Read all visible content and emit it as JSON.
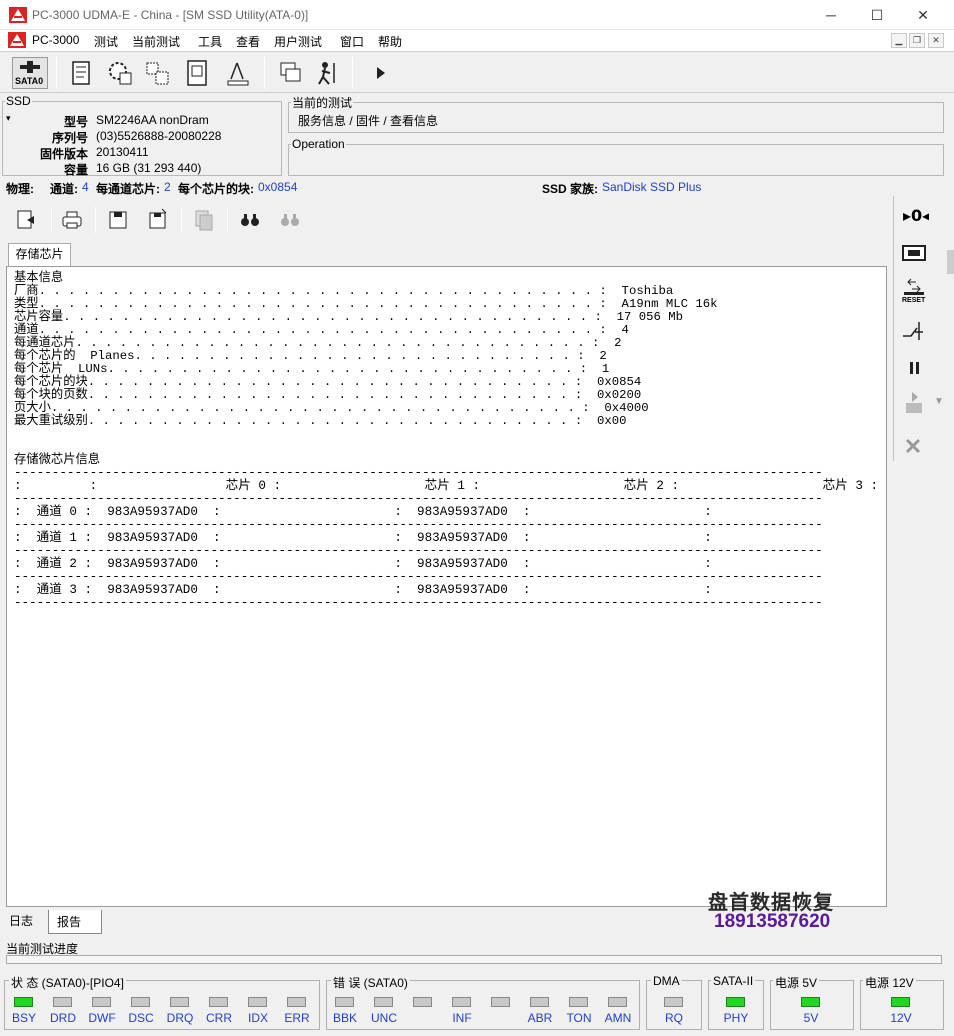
{
  "window": {
    "title": "PC-3000 UDMA-E - China - [SM SSD Utility(ATA-0)]",
    "min": "─",
    "max": "☐",
    "close": "✕"
  },
  "menu": [
    "PC-3000",
    "测试",
    "当前测试",
    "工具",
    "查看",
    "用户测试",
    "窗口",
    "帮助"
  ],
  "toolbar": {
    "sata_label": "SATA0"
  },
  "ssd": {
    "legend": "SSD",
    "model_label": "型号",
    "model": "SM2246AA nonDram",
    "serial_label": "序列号",
    "serial": "(03)5526888-20080228",
    "fw_label": "固件版本",
    "fw": "20130411",
    "cap_label": "容量",
    "cap": "16 GB (31 293 440)"
  },
  "current_test": {
    "legend": "当前的测试",
    "value": "服务信息 / 固件 / 查看信息"
  },
  "operation": {
    "legend": "Operation"
  },
  "phys": {
    "label": "物理:",
    "ch_label": "通道:",
    "ch": "4",
    "cpc_label": "每通道芯片:",
    "cpc": "2",
    "bpc_label": "每个芯片的块:",
    "bpc": "0x0854",
    "family_label": "SSD 家族:",
    "family": "SanDisk SSD Plus"
  },
  "tab": "存储芯片",
  "report": {
    "text": "基本信息\n厂商. . . . . . . . . . . . . . . . . . . . . . . . . . . . . . . . . . . . . . :  Toshiba\n类型. . . . . . . . . . . . . . . . . . . . . . . . . . . . . . . . . . . . . . :  A19nm MLC 16k\n芯片容量. . . . . . . . . . . . . . . . . . . . . . . . . . . . . . . . . . . . :  17 056 Mb\n通道. . . . . . . . . . . . . . . . . . . . . . . . . . . . . . . . . . . . . . :  4\n每通道芯片. . . . . . . . . . . . . . . . . . . . . . . . . . . . . . . . . . . :  2\n每个芯片的  Planes. . . . . . . . . . . . . . . . . . . . . . . . . . . . . . :  2\n每个芯片  LUNs. . . . . . . . . . . . . . . . . . . . . . . . . . . . . . . . :  1\n每个芯片的块. . . . . . . . . . . . . . . . . . . . . . . . . . . . . . . . . :  0x0854\n每个块的页数. . . . . . . . . . . . . . . . . . . . . . . . . . . . . . . . . :  0x0200\n页大小. . . . . . . . . . . . . . . . . . . . . . . . . . . . . . . . . . . . :  0x4000\n最大重试级别. . . . . . . . . . . . . . . . . . . . . . . . . . . . . . . . . :  0x00",
    "chip_title": "存储微芯片信息",
    "chip_table": "-----------------------------------------------------------------------------------------------------------\n:         :                 芯片 0 :                   芯片 1 :                   芯片 2 :                   芯片 3 :\n-----------------------------------------------------------------------------------------------------------\n:  通道 0 :  983A95937AD0  :                       :  983A95937AD0  :                       :\n-----------------------------------------------------------------------------------------------------------\n:  通道 1 :  983A95937AD0  :                       :  983A95937AD0  :                       :\n-----------------------------------------------------------------------------------------------------------\n:  通道 2 :  983A95937AD0  :                       :  983A95937AD0  :                       :\n-----------------------------------------------------------------------------------------------------------\n:  通道 3 :  983A95937AD0  :                       :  983A95937AD0  :                       :\n-----------------------------------------------------------------------------------------------------------"
  },
  "sidebar": {
    "reset_label": "RESET"
  },
  "bottom_tabs": [
    "日志",
    "报告"
  ],
  "watermark": {
    "line1": "盘首数据恢复",
    "line2": "18913587620"
  },
  "progress": {
    "label": "当前测试进度"
  },
  "status": {
    "state": {
      "title": "状 态 (SATA0)-[PIO4]",
      "leds": [
        {
          "l": "BSY",
          "on": true
        },
        {
          "l": "DRD",
          "on": false
        },
        {
          "l": "DWF",
          "on": false
        },
        {
          "l": "DSC",
          "on": false
        },
        {
          "l": "DRQ",
          "on": false
        },
        {
          "l": "CRR",
          "on": false
        },
        {
          "l": "IDX",
          "on": false
        },
        {
          "l": "ERR",
          "on": false
        }
      ]
    },
    "error": {
      "title": "错 误 (SATA0)",
      "leds": [
        {
          "l": "BBK",
          "on": false
        },
        {
          "l": "UNC",
          "on": false
        },
        {
          "l": "",
          "on": false
        },
        {
          "l": "INF",
          "on": false
        },
        {
          "l": "",
          "on": false
        },
        {
          "l": "ABR",
          "on": false
        },
        {
          "l": "TON",
          "on": false
        },
        {
          "l": "AMN",
          "on": false
        }
      ]
    },
    "dma": {
      "title": "DMA",
      "leds": [
        {
          "l": "RQ",
          "on": false
        }
      ]
    },
    "sata2": {
      "title": "SATA-II",
      "leds": [
        {
          "l": "PHY",
          "on": true
        }
      ]
    },
    "p5": {
      "title": "电源 5V",
      "leds": [
        {
          "l": "5V",
          "on": true
        }
      ]
    },
    "p12": {
      "title": "电源 12V",
      "leds": [
        {
          "l": "12V",
          "on": true
        }
      ]
    }
  },
  "colors": {
    "led_on": "#1fd81f",
    "link": "#1f3fd0",
    "watermark_phone": "#5b1a9c"
  }
}
